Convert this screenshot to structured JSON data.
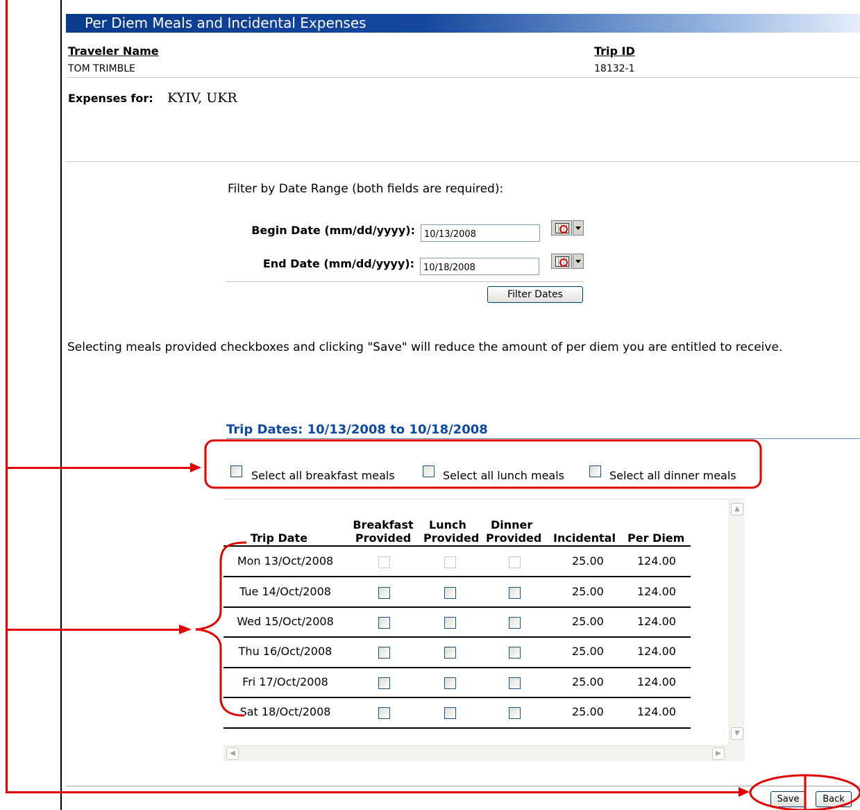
{
  "page": {
    "title": "Per Diem Meals and Incidental Expenses"
  },
  "traveler": {
    "name_label": "Traveler Name",
    "name_value": "TOM TRIMBLE",
    "trip_label": "Trip ID",
    "trip_value": "18132-1"
  },
  "expenses": {
    "label": "Expenses for:",
    "location": "KYIV, UKR"
  },
  "filter": {
    "heading": "Filter by Date Range (both fields are required):",
    "begin_label": "Begin Date (mm/dd/yyyy):",
    "begin_value": "10/13/2008",
    "end_label": "End Date (mm/dd/yyyy):",
    "end_value": "10/18/2008",
    "button_label": "Filter Dates"
  },
  "notice": "Selecting meals provided checkboxes and clicking \"Save\" will reduce the amount of per diem you are entitled to receive.",
  "trip_dates_heading": "Trip Dates: 10/13/2008 to 10/18/2008",
  "select_all": {
    "breakfast": "Select all breakfast meals",
    "lunch": "Select all lunch meals",
    "dinner": "Select all dinner meals"
  },
  "table": {
    "headers": {
      "trip_date": "Trip Date",
      "breakfast_1": "Breakfast",
      "breakfast_2": "Provided",
      "lunch_1": "Lunch",
      "lunch_2": "Provided",
      "dinner_1": "Dinner",
      "dinner_2": "Provided",
      "incidental": "Incidental",
      "per_diem": "Per Diem"
    },
    "rows": [
      {
        "date": "Mon 13/Oct/2008",
        "incidental": "25.00",
        "per_diem": "124.00",
        "disabled": true
      },
      {
        "date": "Tue 14/Oct/2008",
        "incidental": "25.00",
        "per_diem": "124.00",
        "disabled": false
      },
      {
        "date": "Wed 15/Oct/2008",
        "incidental": "25.00",
        "per_diem": "124.00",
        "disabled": false
      },
      {
        "date": "Thu 16/Oct/2008",
        "incidental": "25.00",
        "per_diem": "124.00",
        "disabled": false
      },
      {
        "date": "Fri 17/Oct/2008",
        "incidental": "25.00",
        "per_diem": "124.00",
        "disabled": false
      },
      {
        "date": "Sat 18/Oct/2008",
        "incidental": "25.00",
        "per_diem": "124.00",
        "disabled": false
      }
    ]
  },
  "actions": {
    "save_label": "Save",
    "back_label": "Back"
  },
  "colors": {
    "title_bar": "#0a3a8c",
    "heading_blue": "#0b4aa2",
    "annotation_red": "#e00000"
  }
}
